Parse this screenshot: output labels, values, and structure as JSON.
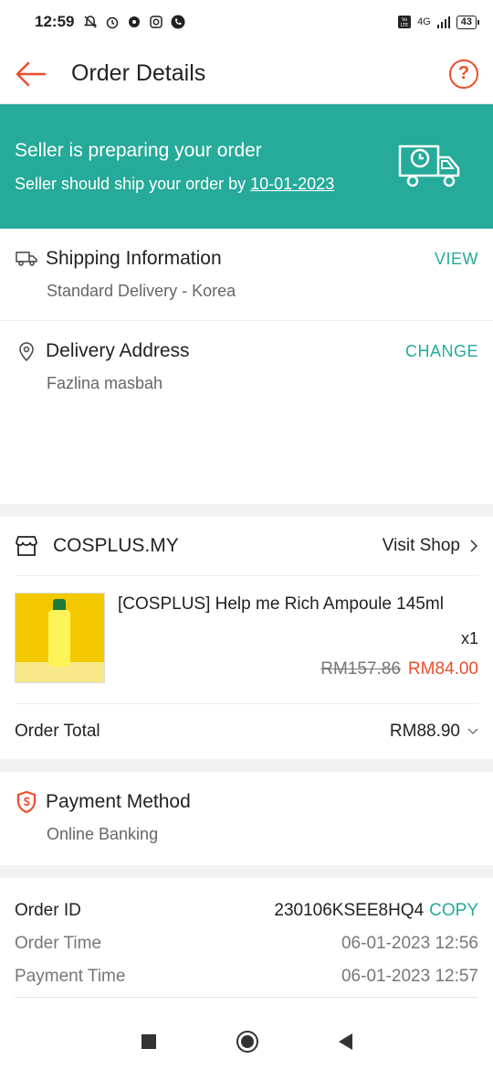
{
  "status_bar": {
    "time": "12:59",
    "battery": "43",
    "network": "4G",
    "icons_left": [
      "mute-icon",
      "alarm-icon",
      "chat-icon",
      "instagram-icon",
      "phone-icon"
    ],
    "icons_right": [
      "volte-icon",
      "signal-icon",
      "battery-icon"
    ]
  },
  "header": {
    "title": "Order Details",
    "help_label": "?"
  },
  "banner": {
    "title": "Seller is preparing your order",
    "subtitle_prefix": "Seller should ship your order by ",
    "ship_by_date": "10-01-2023"
  },
  "shipping": {
    "title": "Shipping Information",
    "action": "VIEW",
    "method": "Standard Delivery - Korea"
  },
  "address": {
    "title": "Delivery Address",
    "action": "CHANGE",
    "name": "Fazlina masbah"
  },
  "shop": {
    "name": "COSPLUS.MY",
    "visit_label": "Visit Shop"
  },
  "product": {
    "name": "[COSPLUS]  Help me Rich Ampoule 145ml",
    "quantity": "x1",
    "original_price": "RM157.86",
    "price": "RM84.00"
  },
  "order_total": {
    "label": "Order Total",
    "value": "RM88.90"
  },
  "payment": {
    "title": "Payment Method",
    "method": "Online Banking"
  },
  "order_info": {
    "order_id_label": "Order ID",
    "order_id": "230106KSEE8HQ4",
    "copy_label": "COPY",
    "order_time_label": "Order Time",
    "order_time": "06-01-2023 12:56",
    "payment_time_label": "Payment Time",
    "payment_time": "06-01-2023 12:57"
  },
  "colors": {
    "accent": "#ee4d2d",
    "teal": "#26aa99"
  }
}
